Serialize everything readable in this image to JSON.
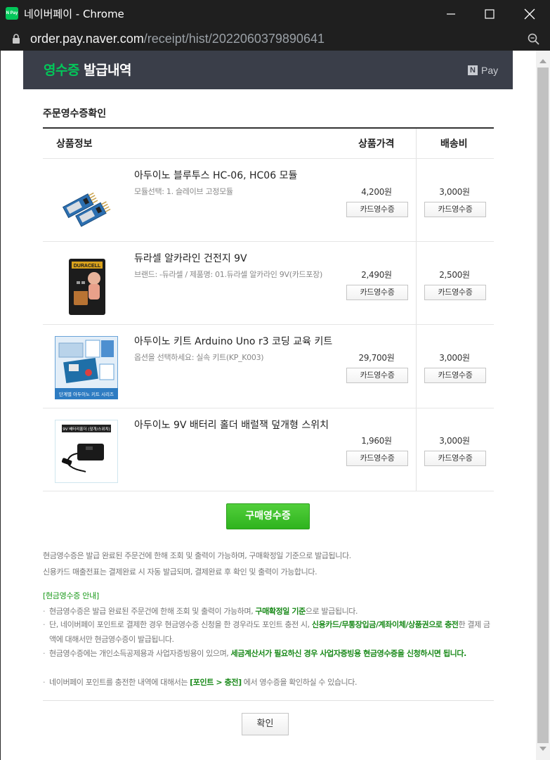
{
  "window": {
    "app_icon_text": "N Pay",
    "title": "네이버페이 - Chrome",
    "url_host": "order.pay.naver.com",
    "url_path": "/receipt/hist/2022060379890641"
  },
  "header": {
    "title_green": "영수증",
    "title_white": " 발급내역",
    "brand_mark": "N",
    "brand_text": "Pay"
  },
  "section_title": "주문영수증확인",
  "columns": {
    "product": "상품정보",
    "price": "상품가격",
    "shipping": "배송비"
  },
  "items": [
    {
      "name": "아두이노 블루투스 HC-06, HC06 모듈",
      "option": "모듈선택: 1. 슬레이브 고정모듈",
      "price": "4,200원",
      "shipping": "3,000원",
      "price_button": "카드영수증",
      "shipping_button": "카드영수증"
    },
    {
      "name": "듀라셀 알카라인 건전지 9V",
      "option": "브랜드: -듀라셀 / 제품명: 01.듀라셀 알카라인 9V(카드포장)",
      "price": "2,490원",
      "shipping": "2,500원",
      "price_button": "카드영수증",
      "shipping_button": "카드영수증",
      "thumb_label": "DURACELL"
    },
    {
      "name": "아두이노 키트 Arduino Uno r3 코딩 교육 키트",
      "option": "옵션을 선택하세요: 실속 키트(KP_K003)",
      "price": "29,700원",
      "shipping": "3,000원",
      "price_button": "카드영수증",
      "shipping_button": "카드영수증",
      "thumb_label": "단계별 아두이노 키트 시리즈"
    },
    {
      "name": "아두이노 9V 배터리 홀더 배럴잭 덮개형 스위치",
      "option": "",
      "price": "1,960원",
      "shipping": "3,000원",
      "price_button": "카드영수증",
      "shipping_button": "카드영수증",
      "thumb_label": "9V 배터리홀더 (덮개/스위치)"
    }
  ],
  "purchase_receipt_button": "구매영수증",
  "notes": [
    "현금영수증은 발급 완료된 주문건에 한해 조회 및 출력이 가능하며, 구매확정일 기준으로 발급됩니다.",
    "신용카드 매출전표는 결제완료 시 자동 발급되며, 결제완료 후 확인 및 출력이 가능합니다."
  ],
  "guide": {
    "title": "[현금영수증 안내]",
    "b1_pre": "현금영수증은 발급 완료된 주문건에 한해 조회 및 출력이 가능하며, ",
    "b1_em": "구매확정일 기준",
    "b1_post": "으로 발급됩니다.",
    "b2_pre": "단, 네이버페이 포인트로 결제한 경우 현금영수증 신청을 한 경우라도 포인트 충전 시, ",
    "b2_em": "신용카드/무통장입금/계좌이체/상품권으로 충전",
    "b2_post": "한 결제 금액에 대해서만 현금영수증이 발급됩니다.",
    "b3_pre": "현금영수증에는 개인소득공제용과 사업자증빙용이 있으며, ",
    "b3_em": "세금계산서가 필요하신 경우 사업자증빙용 현금영수증을 신청하시면 됩니다.",
    "b4_pre": "네이버페이 포인트를 충전한 내역에 대해서는 ",
    "b4_em": "[포인트 > 충전]",
    "b4_post": " 에서 영수증을 확인하실 수 있습니다."
  },
  "confirm_button": "확인",
  "colors": {
    "naver_green": "#03c75a",
    "banner_bg": "#3a3e49",
    "receipt_button": "#3cbf2a"
  }
}
